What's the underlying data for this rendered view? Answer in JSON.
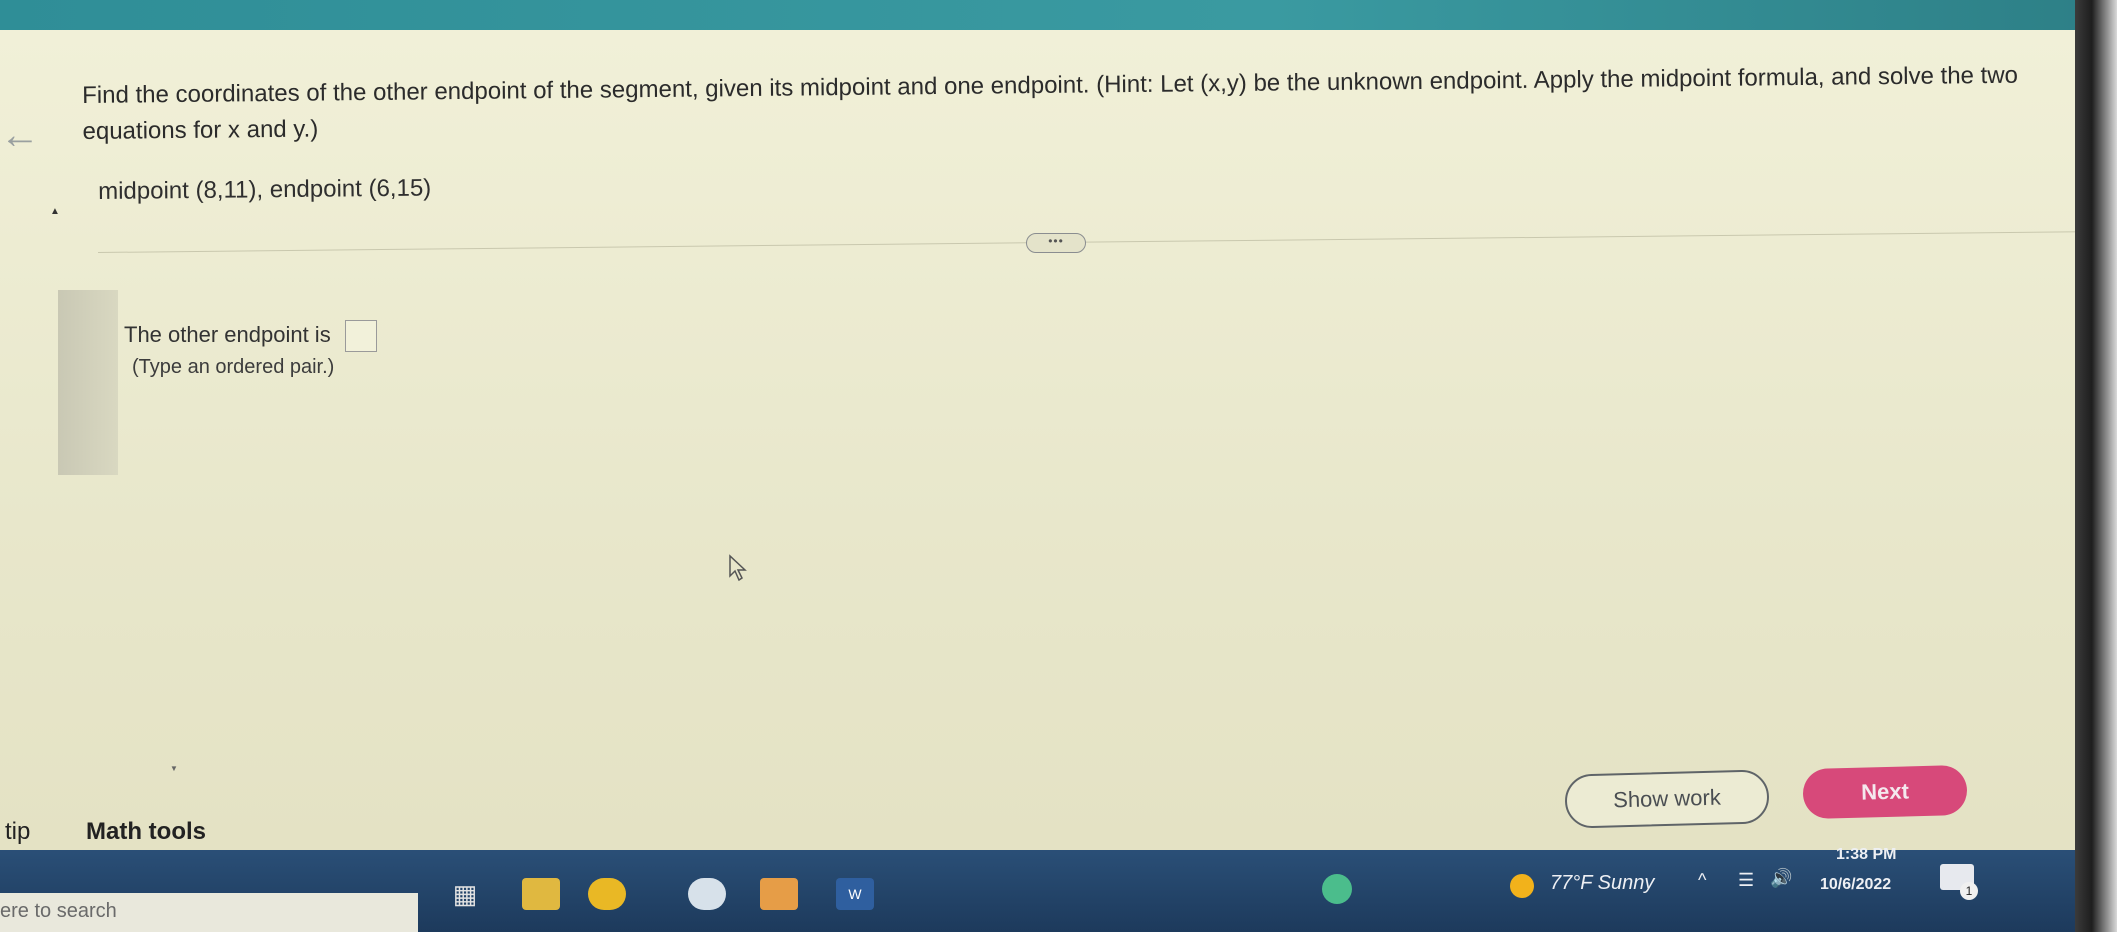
{
  "question": {
    "text": "Find the coordinates of the other endpoint of the segment, given its midpoint and one endpoint. (Hint: Let (x,y) be the unknown endpoint. Apply the midpoint formula, and solve the two equations for x and y.)",
    "given": "midpoint (8,11), endpoint (6,15)"
  },
  "more_button": {
    "label": "•••"
  },
  "answer": {
    "label": "The other endpoint is",
    "value": "",
    "hint": "(Type an ordered pair.)"
  },
  "footer": {
    "tip_label": "tip",
    "math_tools_label": "Math tools",
    "show_work_label": "Show work",
    "next_label": "Next"
  },
  "taskbar": {
    "search_placeholder": "ere to search",
    "word_icon_label": "W",
    "weather": "77°F  Sunny",
    "time": "1:38 PM",
    "date": "10/6/2022",
    "notification_count": "1"
  },
  "colors": {
    "page_bg": "#f1f0d8",
    "next_button": "#d7497a",
    "topbar": "#2f8e97",
    "taskbar": "#1d3a5c"
  }
}
